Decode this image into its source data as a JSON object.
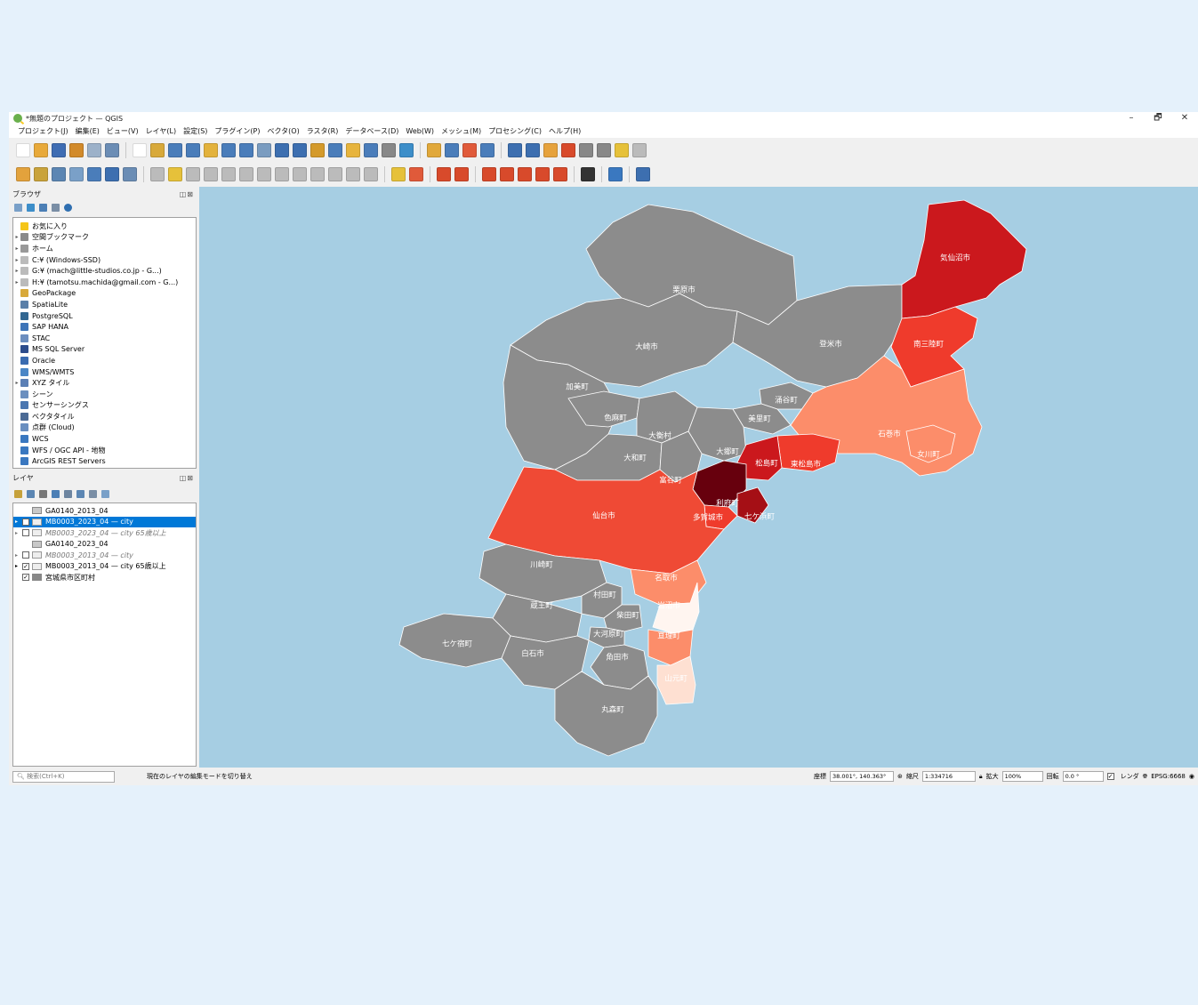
{
  "window": {
    "title": "*無題のプロジェクト — QGIS",
    "controls": {
      "minimize": "–",
      "maximize": "🗗",
      "close": "✕"
    }
  },
  "menu": [
    "プロジェクト(J)",
    "編集(E)",
    "ビュー(V)",
    "レイヤ(L)",
    "設定(S)",
    "プラグイン(P)",
    "ベクタ(O)",
    "ラスタ(R)",
    "データベース(D)",
    "Web(W)",
    "メッシュ(M)",
    "プロセシング(C)",
    "ヘルプ(H)"
  ],
  "browser": {
    "title": "ブラウザ",
    "items": [
      {
        "label": "お気に入り",
        "icon": "star-icon",
        "color": "#f5c518",
        "arrow": ""
      },
      {
        "label": "空間ブックマーク",
        "icon": "bookmark-icon",
        "color": "#8a8a8a",
        "arrow": "▸"
      },
      {
        "label": "ホーム",
        "icon": "home-icon",
        "color": "#999",
        "arrow": "▸"
      },
      {
        "label": "C:¥ (Windows-SSD)",
        "icon": "drive-icon",
        "color": "#bbb",
        "arrow": "▸"
      },
      {
        "label": "G:¥ (mach@little-studios.co.jp - G...)",
        "icon": "drive-icon",
        "color": "#bbb",
        "arrow": "▸"
      },
      {
        "label": "H:¥ (tamotsu.machida@gmail.com - G...)",
        "icon": "drive-icon",
        "color": "#bbb",
        "arrow": "▸"
      },
      {
        "label": "GeoPackage",
        "icon": "geopackage-icon",
        "color": "#d8a93a",
        "arrow": ""
      },
      {
        "label": "SpatiaLite",
        "icon": "feather-icon",
        "color": "#5a7fa8",
        "arrow": ""
      },
      {
        "label": "PostgreSQL",
        "icon": "elephant-icon",
        "color": "#336791",
        "arrow": ""
      },
      {
        "label": "SAP HANA",
        "icon": "database-icon",
        "color": "#3d74b8",
        "arrow": ""
      },
      {
        "label": "STAC",
        "icon": "stac-icon",
        "color": "#6c8ebf",
        "arrow": ""
      },
      {
        "label": "MS SQL Server",
        "icon": "mssql-icon",
        "color": "#2c4c8c",
        "arrow": ""
      },
      {
        "label": "Oracle",
        "icon": "oracle-icon",
        "color": "#3a6bb0",
        "arrow": ""
      },
      {
        "label": "WMS/WMTS",
        "icon": "globe-icon",
        "color": "#4a86c6",
        "arrow": ""
      },
      {
        "label": "XYZ タイル",
        "icon": "grid-icon",
        "color": "#5b7fb5",
        "arrow": "▸"
      },
      {
        "label": "シーン",
        "icon": "scene-icon",
        "color": "#6b8fbf",
        "arrow": ""
      },
      {
        "label": "センサーシングス",
        "icon": "sensor-icon",
        "color": "#4a76b0",
        "arrow": ""
      },
      {
        "label": "ベクタタイル",
        "icon": "vectortile-icon",
        "color": "#4b6a95",
        "arrow": ""
      },
      {
        "label": "点群 (Cloud)",
        "icon": "cloud-icon",
        "color": "#6a8fc0",
        "arrow": ""
      },
      {
        "label": "WCS",
        "icon": "globe-icon",
        "color": "#3a78c0",
        "arrow": ""
      },
      {
        "label": "WFS / OGC API - 地物",
        "icon": "globe-icon",
        "color": "#3a78c0",
        "arrow": ""
      },
      {
        "label": "ArcGIS REST Servers",
        "icon": "globe-icon",
        "color": "#3a78c0",
        "arrow": ""
      }
    ]
  },
  "layers": {
    "title": "レイヤ",
    "items": [
      {
        "label": "GA0140_2013_04",
        "type": "table",
        "checked": false,
        "has_checkbox": false,
        "arrow": "",
        "state": "normal"
      },
      {
        "label": "MB0003_2023_04 — city",
        "type": "vector",
        "checked": false,
        "has_checkbox": true,
        "arrow": "▸",
        "state": "selected"
      },
      {
        "label": "MB0003_2023_04 — city 65歳以上",
        "type": "vector",
        "checked": false,
        "has_checkbox": true,
        "arrow": "▸",
        "state": "dim"
      },
      {
        "label": "GA0140_2023_04",
        "type": "table",
        "checked": false,
        "has_checkbox": false,
        "arrow": "",
        "state": "normal"
      },
      {
        "label": "MB0003_2013_04 — city",
        "type": "vector",
        "checked": false,
        "has_checkbox": true,
        "arrow": "▸",
        "state": "dim"
      },
      {
        "label": "MB0003_2013_04 — city 65歳以上",
        "type": "vector",
        "checked": true,
        "has_checkbox": true,
        "arrow": "▸",
        "state": "normal"
      },
      {
        "label": "宮城県市区町村",
        "type": "polygon",
        "checked": true,
        "has_checkbox": true,
        "arrow": "",
        "state": "normal"
      }
    ]
  },
  "map": {
    "background": "#a6cee3",
    "municipalities": [
      {
        "name": "栗原市",
        "color": "#8c8c8c"
      },
      {
        "name": "大崎市",
        "color": "#8c8c8c"
      },
      {
        "name": "登米市",
        "color": "#8c8c8c"
      },
      {
        "name": "加美町",
        "color": "#8c8c8c"
      },
      {
        "name": "色麻町",
        "color": "#8c8c8c"
      },
      {
        "name": "涌谷町",
        "color": "#8c8c8c"
      },
      {
        "name": "美里町",
        "color": "#8c8c8c"
      },
      {
        "name": "大衡村",
        "color": "#8c8c8c"
      },
      {
        "name": "大和町",
        "color": "#8c8c8c"
      },
      {
        "name": "大郷町",
        "color": "#8c8c8c"
      },
      {
        "name": "富谷町",
        "color": "#8c8c8c"
      },
      {
        "name": "気仙沼市",
        "color": "#cb181d"
      },
      {
        "name": "南三陸町",
        "color": "#ef3b2c"
      },
      {
        "name": "石巻市",
        "color": "#fc8d6a"
      },
      {
        "name": "女川町",
        "color": "#fc8d6a"
      },
      {
        "name": "東松島市",
        "color": "#ef3b2c"
      },
      {
        "name": "松島町",
        "color": "#cb181d"
      },
      {
        "name": "利府町",
        "color": "#67000d"
      },
      {
        "name": "多賀城市",
        "color": "#ef3b2c"
      },
      {
        "name": "七ケ浜町",
        "color": "#a50f15"
      },
      {
        "name": "仙台市",
        "color": "#ef4a35"
      },
      {
        "name": "名取市",
        "color": "#fc8d6a"
      },
      {
        "name": "岩沼市",
        "color": "#fff5f0"
      },
      {
        "name": "亘理町",
        "color": "#fc8d6a"
      },
      {
        "name": "山元町",
        "color": "#fee0d2"
      },
      {
        "name": "川崎町",
        "color": "#8c8c8c"
      },
      {
        "name": "村田町",
        "color": "#8c8c8c"
      },
      {
        "name": "蔵王町",
        "color": "#8c8c8c"
      },
      {
        "name": "柴田町",
        "color": "#8c8c8c"
      },
      {
        "name": "大河原町",
        "color": "#8c8c8c"
      },
      {
        "name": "七ケ宿町",
        "color": "#8c8c8c"
      },
      {
        "name": "白石市",
        "color": "#8c8c8c"
      },
      {
        "name": "角田市",
        "color": "#8c8c8c"
      },
      {
        "name": "丸森町",
        "color": "#8c8c8c"
      }
    ]
  },
  "status": {
    "search_placeholder": "検索(Ctrl+K)",
    "hint": "現在のレイヤの編集モードを切り替え",
    "coord_label": "座標",
    "coord_value": "38.001°, 140.363°",
    "scale_label": "縮尺",
    "scale_value": "1:334716",
    "magnifier_label": "拡大",
    "magnifier_value": "100%",
    "rotation_label": "回転",
    "rotation_value": "0.0 °",
    "render_label": "レンダ",
    "crs": "EPSG:6668"
  }
}
